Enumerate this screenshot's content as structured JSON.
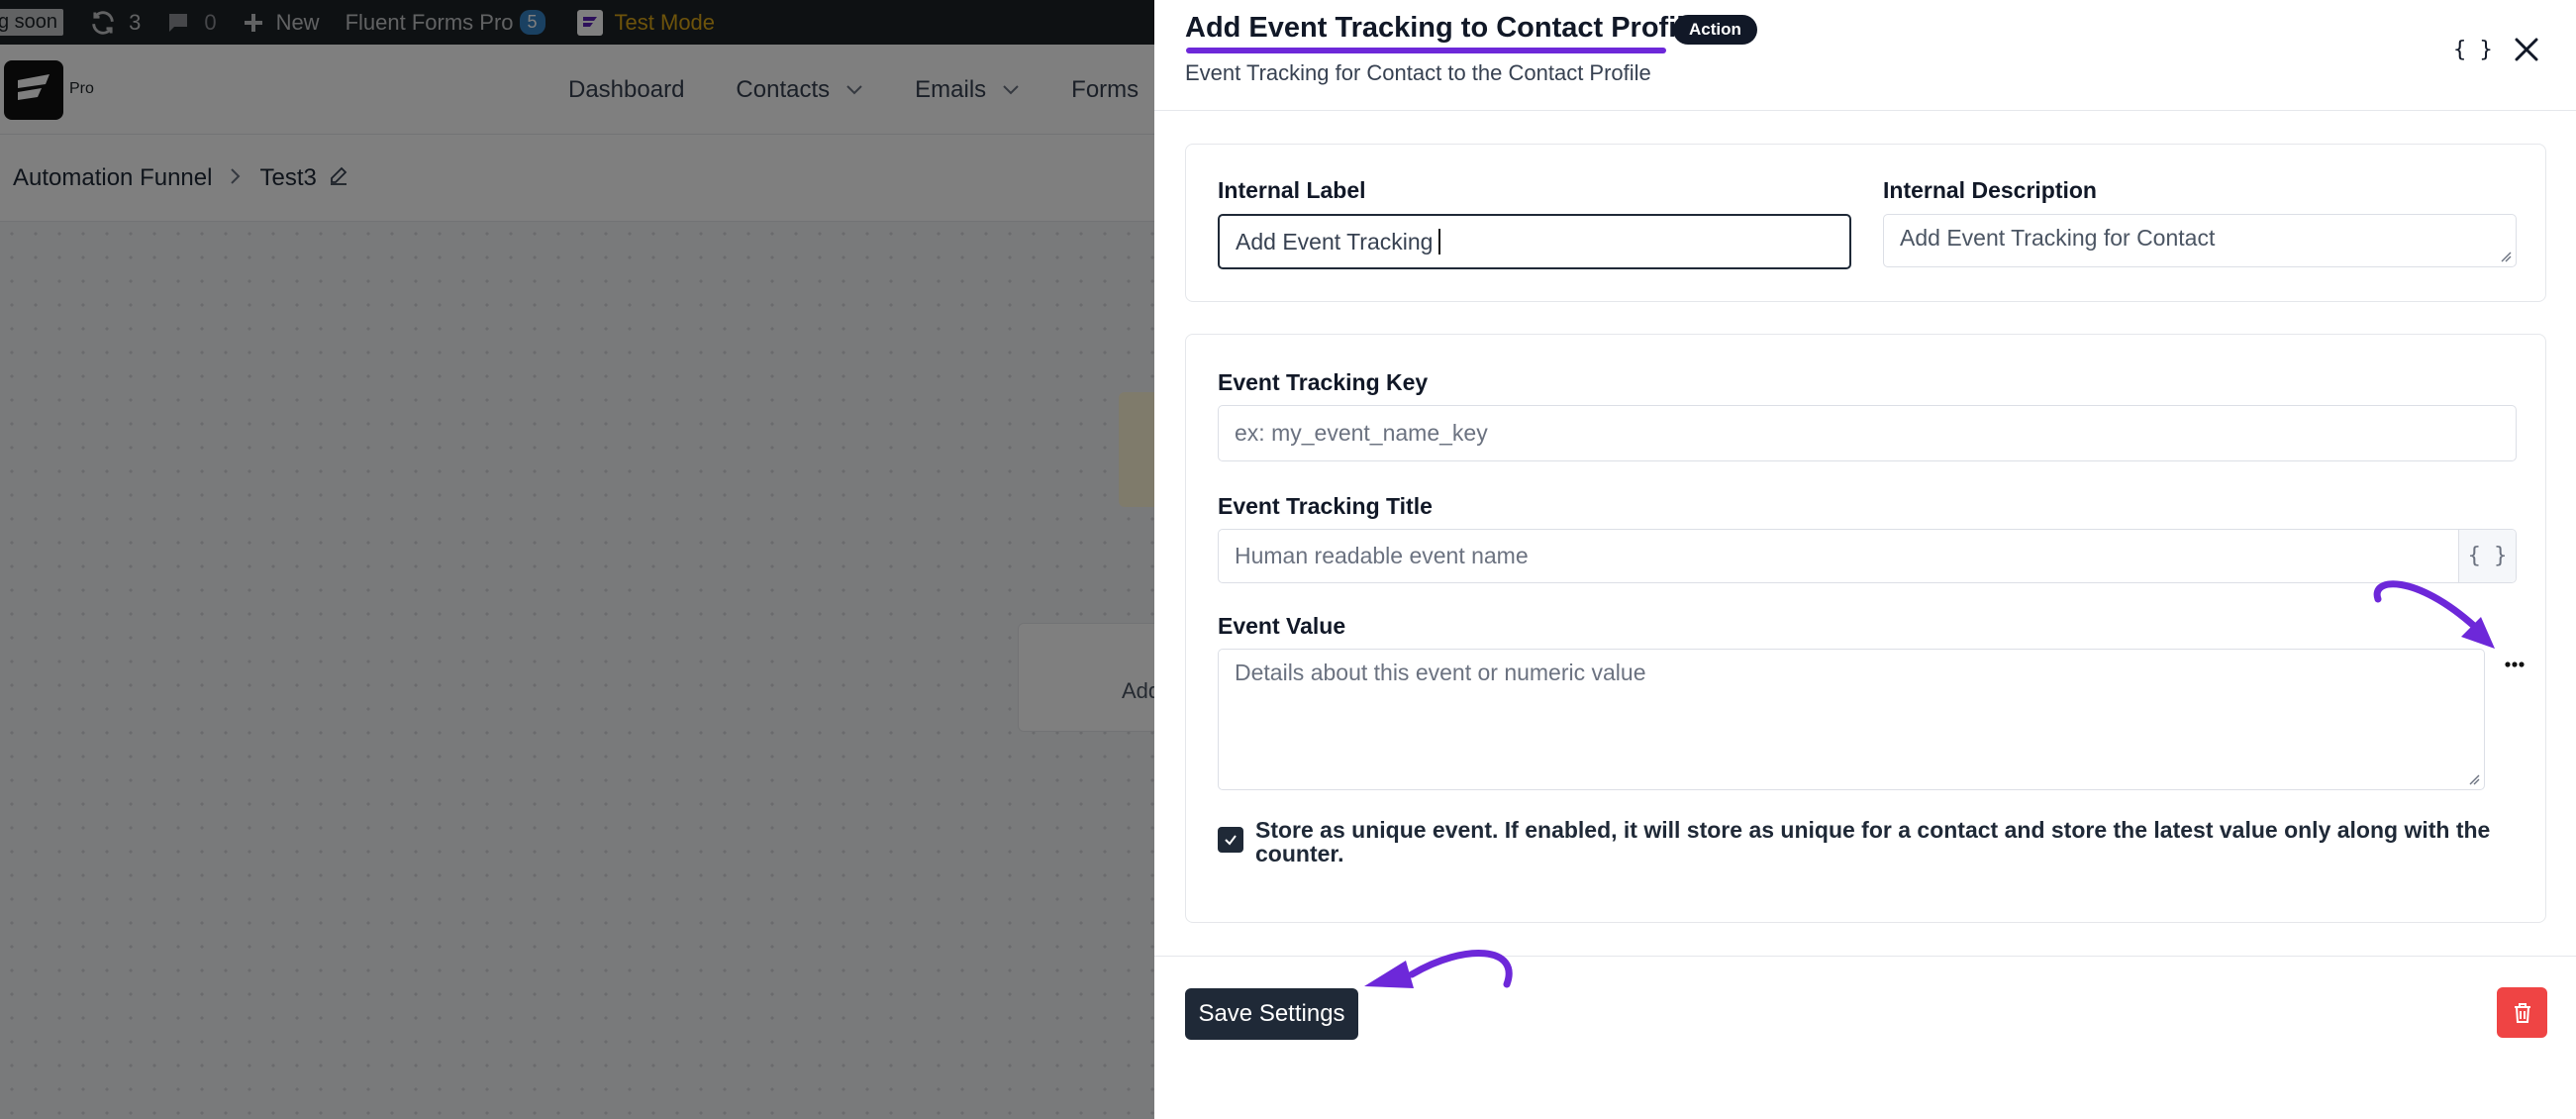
{
  "adminbar": {
    "coming_soon": "g soon",
    "updates_count": "3",
    "comments_count": "0",
    "new_label": "New",
    "plugin_label": "Fluent Forms Pro",
    "plugin_badge": "5",
    "test_mode": "Test Mode"
  },
  "app": {
    "pro_label": "Pro",
    "nav": [
      "Dashboard",
      "Contacts",
      "Emails",
      "Forms"
    ],
    "breadcrumb": [
      "Automation Funnel",
      "Test3"
    ],
    "canvas_node_text": "Add"
  },
  "drawer": {
    "title": "Add Event Tracking to Contact Profile",
    "badge": "Action",
    "subtitle": "Event Tracking for Contact to the Contact Profile",
    "code_btn": "{ }",
    "internal_label": {
      "label": "Internal Label",
      "value": "Add Event Tracking"
    },
    "internal_description": {
      "label": "Internal Description",
      "value": "Add Event Tracking for Contact"
    },
    "event_key": {
      "label": "Event Tracking Key",
      "placeholder": "ex: my_event_name_key"
    },
    "event_title": {
      "label": "Event Tracking Title",
      "placeholder": "Human readable event name",
      "suffix": "{ }"
    },
    "event_value": {
      "label": "Event Value",
      "placeholder": "Details about this event or numeric value"
    },
    "unique_checkbox": {
      "checked": true,
      "label_line1": "Store as unique event. If enabled, it will store as unique for a contact and store the latest value only along with the",
      "label_line2": "counter."
    },
    "save_label": "Save Settings"
  },
  "colors": {
    "accent_purple": "#6d28d9",
    "dark": "#1f2937",
    "danger": "#ef4444"
  }
}
